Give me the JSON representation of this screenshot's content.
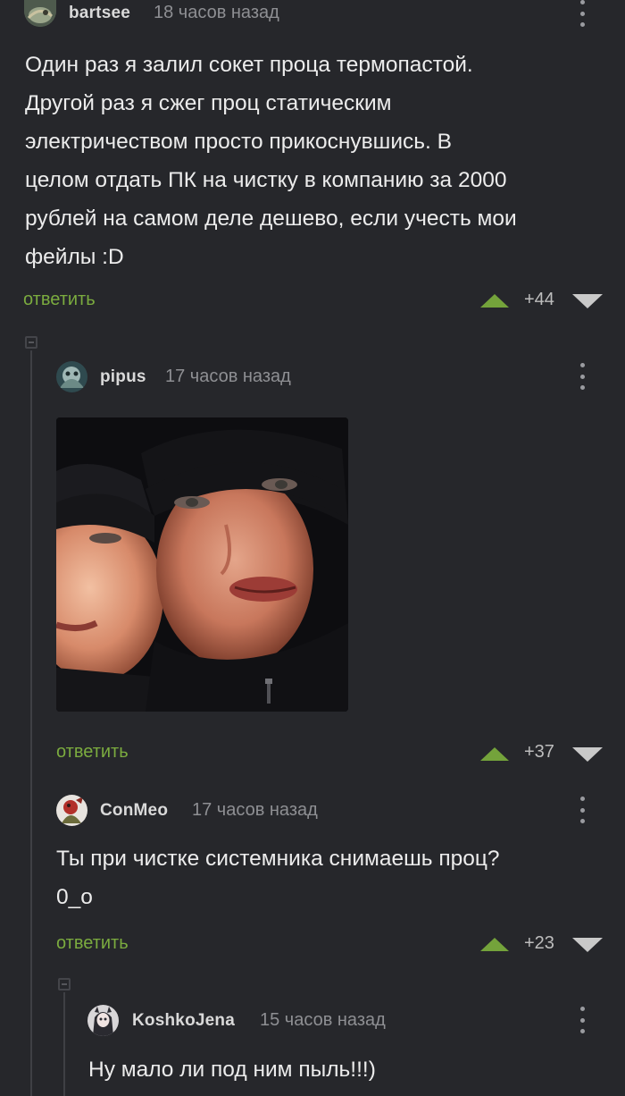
{
  "comments": [
    {
      "username": "bartsee",
      "timestamp": "18 часов назад",
      "lines": [
        "Один раз я залил сокет проца термопастой.",
        "Другой раз я сжег проц статическим",
        "электричеством просто прикоснувшись. В",
        "целом отдать ПК на чистку в компанию за 2000",
        "рублей на самом деле дешево, если учесть мои",
        "фейлы :D"
      ],
      "reply_label": "ответить",
      "rating": "+44"
    },
    {
      "username": "pipus",
      "timestamp": "17 часов назад",
      "lines": [],
      "reply_label": "ответить",
      "rating": "+37"
    },
    {
      "username": "ConMeo",
      "timestamp": "17 часов назад",
      "lines": [
        "Ты при чистке системника снимаешь проц?",
        "0_o"
      ],
      "reply_label": "ответить",
      "rating": "+23"
    },
    {
      "username": "KoshkoJena",
      "timestamp": "15 часов назад",
      "lines": [
        "Ну мало ли под ним пыль!!!)"
      ]
    }
  ],
  "colors": {
    "background": "#26272b",
    "accent_green": "#7bab3f",
    "upvote": "#74a33b",
    "downvote": "#c9c9c9",
    "muted_text": "#8e8f93"
  },
  "icons": {
    "more": "kebab-menu-icon",
    "upvote": "arrow-up-icon",
    "downvote": "arrow-down-icon",
    "collapse": "collapse-thread-icon"
  }
}
